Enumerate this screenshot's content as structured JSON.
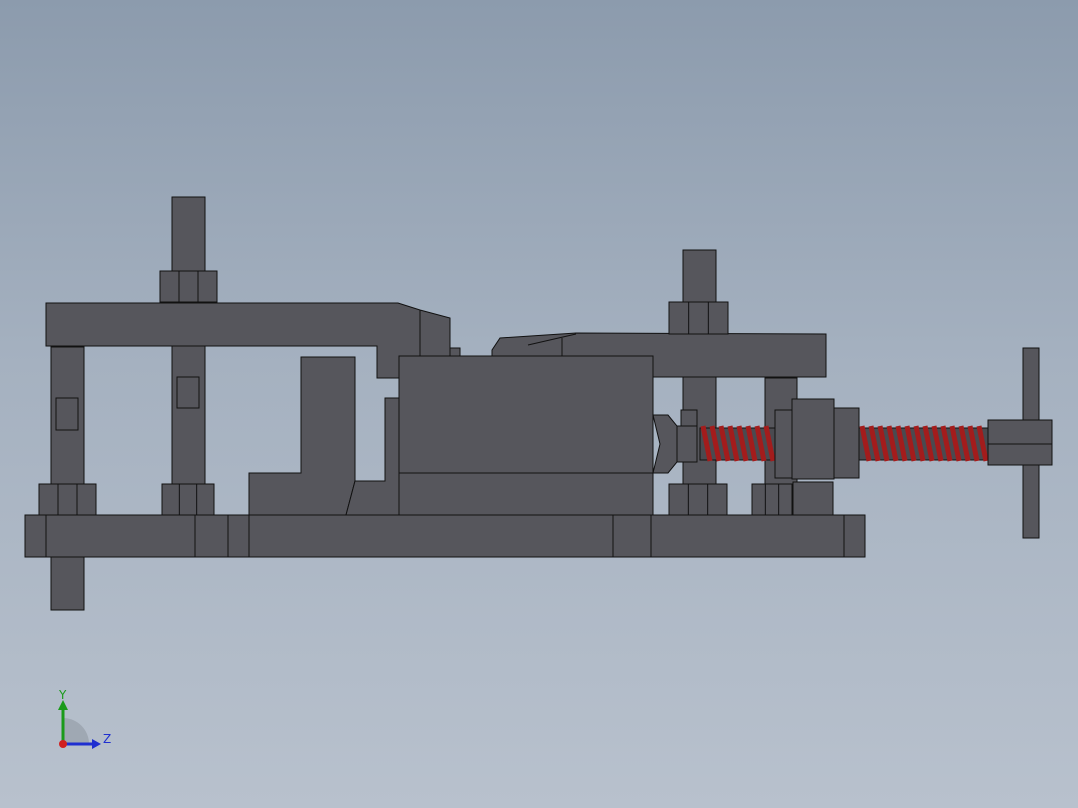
{
  "viewport": {
    "background_top": "#8c9bad",
    "background_bottom": "#b8c1cd"
  },
  "colors": {
    "part_fill": "#56565c",
    "part_fill_dark": "#4a4a50",
    "part_edge": "#111111",
    "spring": "#a31c1c",
    "spring_highlight": "#d04040",
    "axis_y": "#1a9a1a",
    "axis_z": "#1f2fd0",
    "axis_x": "#d02020"
  },
  "triad": {
    "y_label": "Y",
    "z_label": "Z",
    "icon": "coordinate-triad-icon"
  }
}
